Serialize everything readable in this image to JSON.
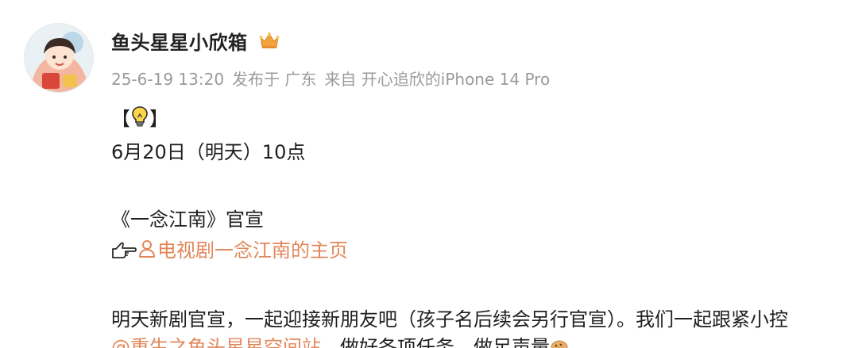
{
  "post": {
    "author": {
      "name": "鱼头星星小欣箱",
      "badge_icon": "crown-icon",
      "avatar_icon": "cartoon-girl-avatar"
    },
    "meta": {
      "time": "25-6-19 13:20",
      "location": "发布于 广东",
      "device": "来自 开心追欣的iPhone 14 Pro"
    },
    "body": {
      "bracket_open": "【",
      "bracket_close": "】",
      "bulb_icon": "lightbulb-icon",
      "date_line": "6月20日（明天）10点",
      "title_line": "《一念江南》官宣",
      "pointer_icon": "pointing-hand-icon",
      "person_icon": "person-icon",
      "page_link": "电视剧一念江南的主页",
      "desc_line": "明天新剧官宣，一起迎接新朋友吧（孩子名后续会另行官宣）。我们一起跟紧小控",
      "mention_link": "@重生之鱼头星星空间站",
      "tail_text": "，做好各项任务，做足声量",
      "cookie_icon": "cookie-emoji-icon"
    }
  },
  "colors": {
    "link": "#e2875a",
    "meta": "#9a9a9a",
    "text": "#1f1f1f"
  }
}
